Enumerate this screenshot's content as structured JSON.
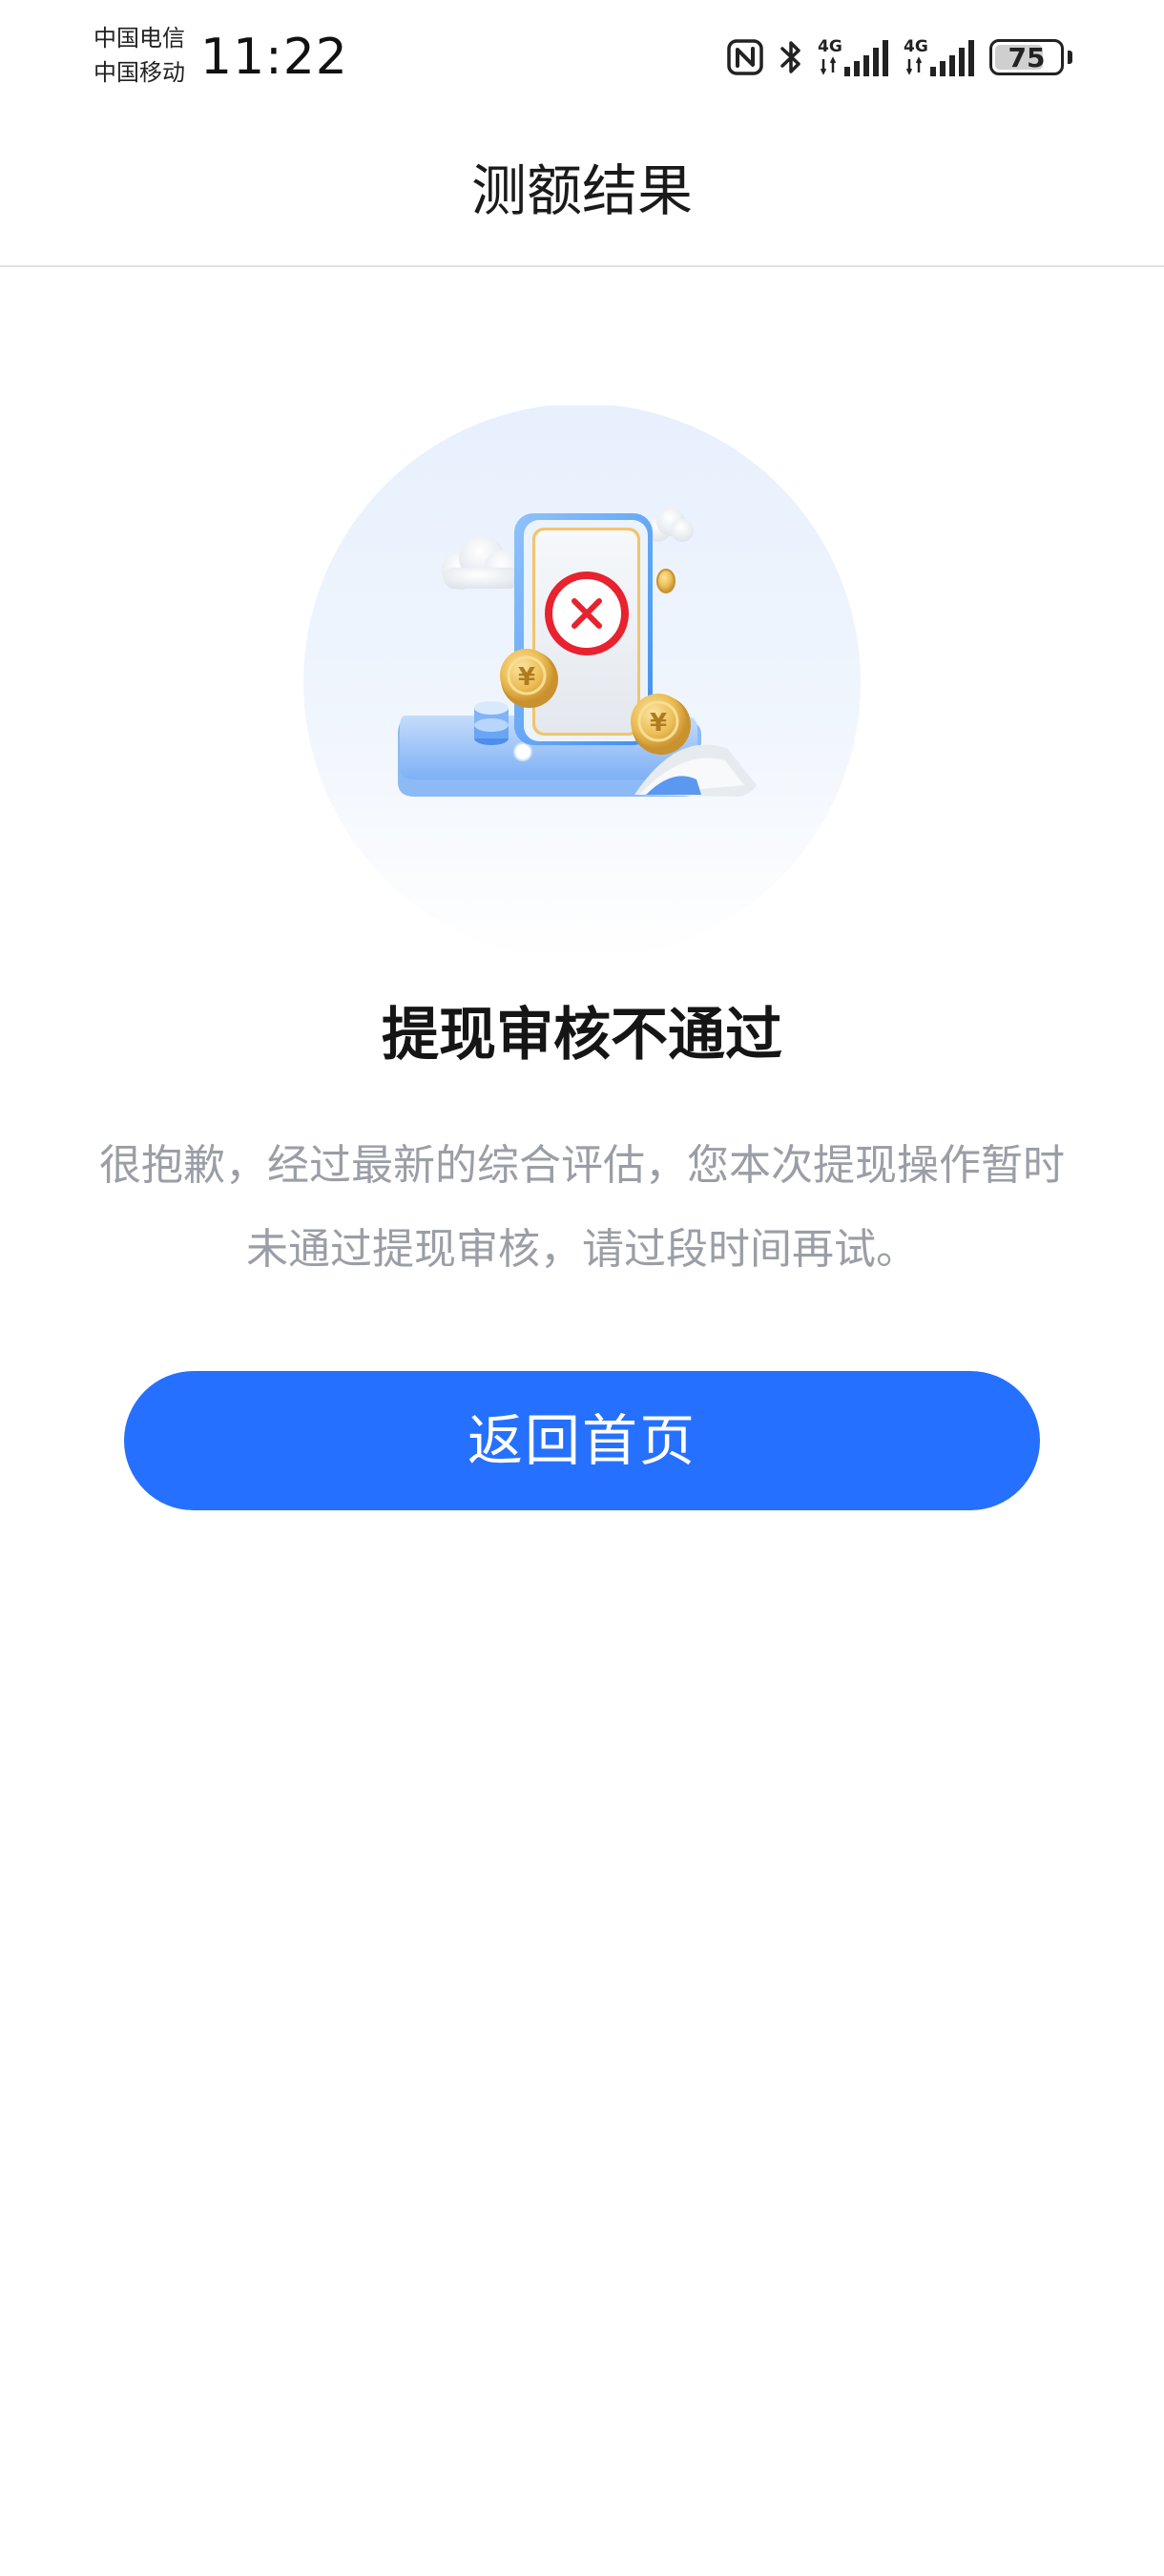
{
  "status_bar": {
    "carrier_1": "中国电信",
    "carrier_2": "中国移动",
    "time": "11:22",
    "signal_1_label": "4G",
    "signal_2_label": "4G",
    "battery_level": "75",
    "battery_fraction": 0.75,
    "icons": [
      "nfc-icon",
      "bluetooth-icon",
      "signal-4g-icon",
      "signal-4g-icon",
      "battery-icon"
    ]
  },
  "header": {
    "title": "测额结果"
  },
  "illustration": {
    "icon": "rejected-phone-illustration"
  },
  "result": {
    "title": "提现审核不通过",
    "description_line_1": "很抱歉，经过最新的综合评估，您本次提现操作暂时",
    "description_line_2": "未通过提现审核，请过段时间再试。"
  },
  "actions": {
    "home_label": "返回首页"
  },
  "colors": {
    "accent": "#2570ff",
    "reject_red": "#e8222e",
    "coin_gold": "#e9b649",
    "muted_text": "#9a9ea6"
  }
}
